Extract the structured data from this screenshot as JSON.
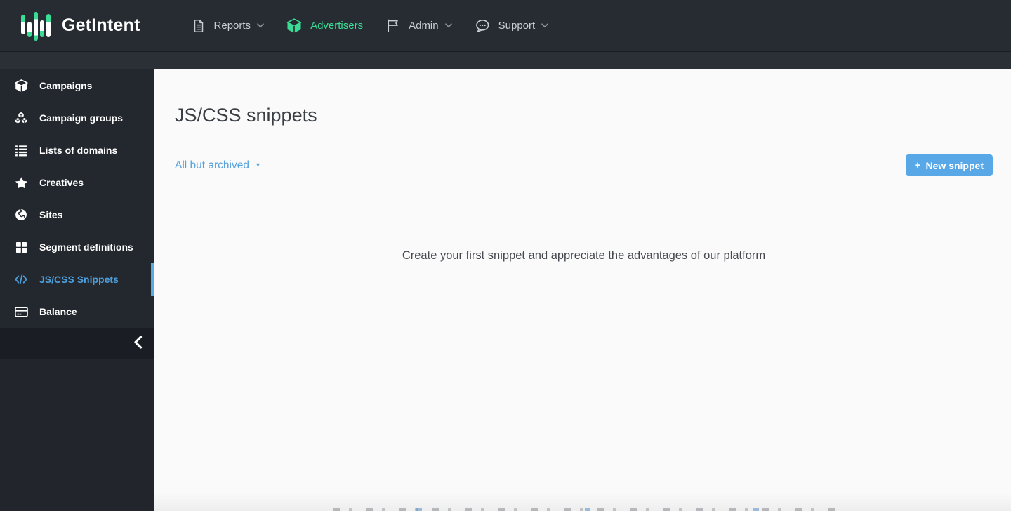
{
  "brand": {
    "name": "GetIntent"
  },
  "colors": {
    "topbar_bg": "#272b32",
    "subband_bg": "#2b2f36",
    "sidebar_bg": "#23272e",
    "collapse_strip_bg": "#1a1d23",
    "content_bg": "#fafafa",
    "accent_green": "#3bdc96",
    "accent_blue": "#4d9fdb",
    "link_blue": "#55a2dc",
    "button_blue": "#58a8e8"
  },
  "icons": {
    "caret_down_glyph": "▾",
    "plus_glyph": "+"
  },
  "topnav": {
    "items": [
      {
        "label": "Reports",
        "icon": "reports-document-icon",
        "has_caret": true,
        "active": false
      },
      {
        "label": "Advertisers",
        "icon": "advertisers-cube-icon",
        "has_caret": false,
        "active": true
      },
      {
        "label": "Admin",
        "icon": "admin-flag-icon",
        "has_caret": true,
        "active": false
      },
      {
        "label": "Support",
        "icon": "support-chat-icon",
        "has_caret": true,
        "active": false
      }
    ]
  },
  "sidebar": {
    "items": [
      {
        "label": "Campaigns",
        "icon": "cube-icon",
        "active": false
      },
      {
        "label": "Campaign groups",
        "icon": "cubes-icon",
        "active": false
      },
      {
        "label": "Lists of domains",
        "icon": "list-icon",
        "active": false
      },
      {
        "label": "Creatives",
        "icon": "star-icon",
        "active": false
      },
      {
        "label": "Sites",
        "icon": "globe-icon",
        "active": false
      },
      {
        "label": "Segment definitions",
        "icon": "grid-icon",
        "active": false
      },
      {
        "label": "JS/CSS Snippets",
        "icon": "code-icon",
        "active": true
      },
      {
        "label": "Balance",
        "icon": "credit-card-icon",
        "active": false
      }
    ],
    "collapse_icon": "chevron-left-icon"
  },
  "main": {
    "title": "JS/CSS snippets",
    "filter": {
      "selected": "All but archived"
    },
    "new_snippet_button": {
      "plus": "+",
      "label": "New snippet"
    },
    "empty_state": "Create your first snippet and appreciate the advantages of our platform"
  }
}
